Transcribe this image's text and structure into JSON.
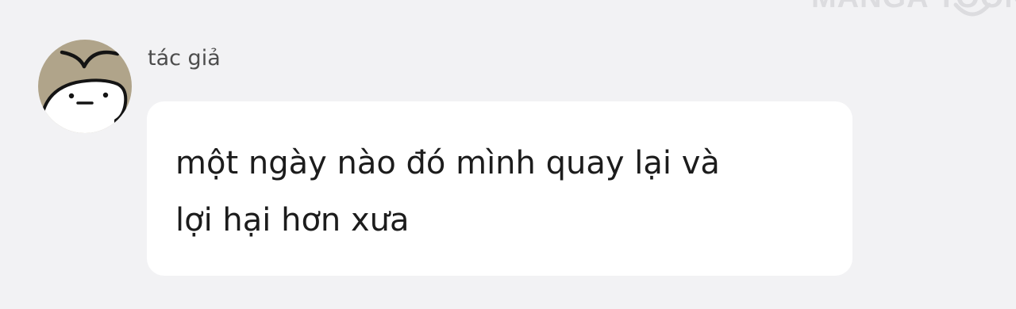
{
  "watermark": {
    "text": "MANGA TOON"
  },
  "author": {
    "name": "tác giả",
    "avatar_icon": "cartoon-face-avatar"
  },
  "message": {
    "text": "một ngày nào đó mình quay lại và\nlợi hại hơn xưa"
  },
  "colors": {
    "background": "#f2f2f4",
    "bubble": "#ffffff",
    "avatar_bg": "#b0a48a",
    "text": "#1c1c1c",
    "author_text": "#4d4d4d",
    "watermark": "#dcdcdf"
  }
}
